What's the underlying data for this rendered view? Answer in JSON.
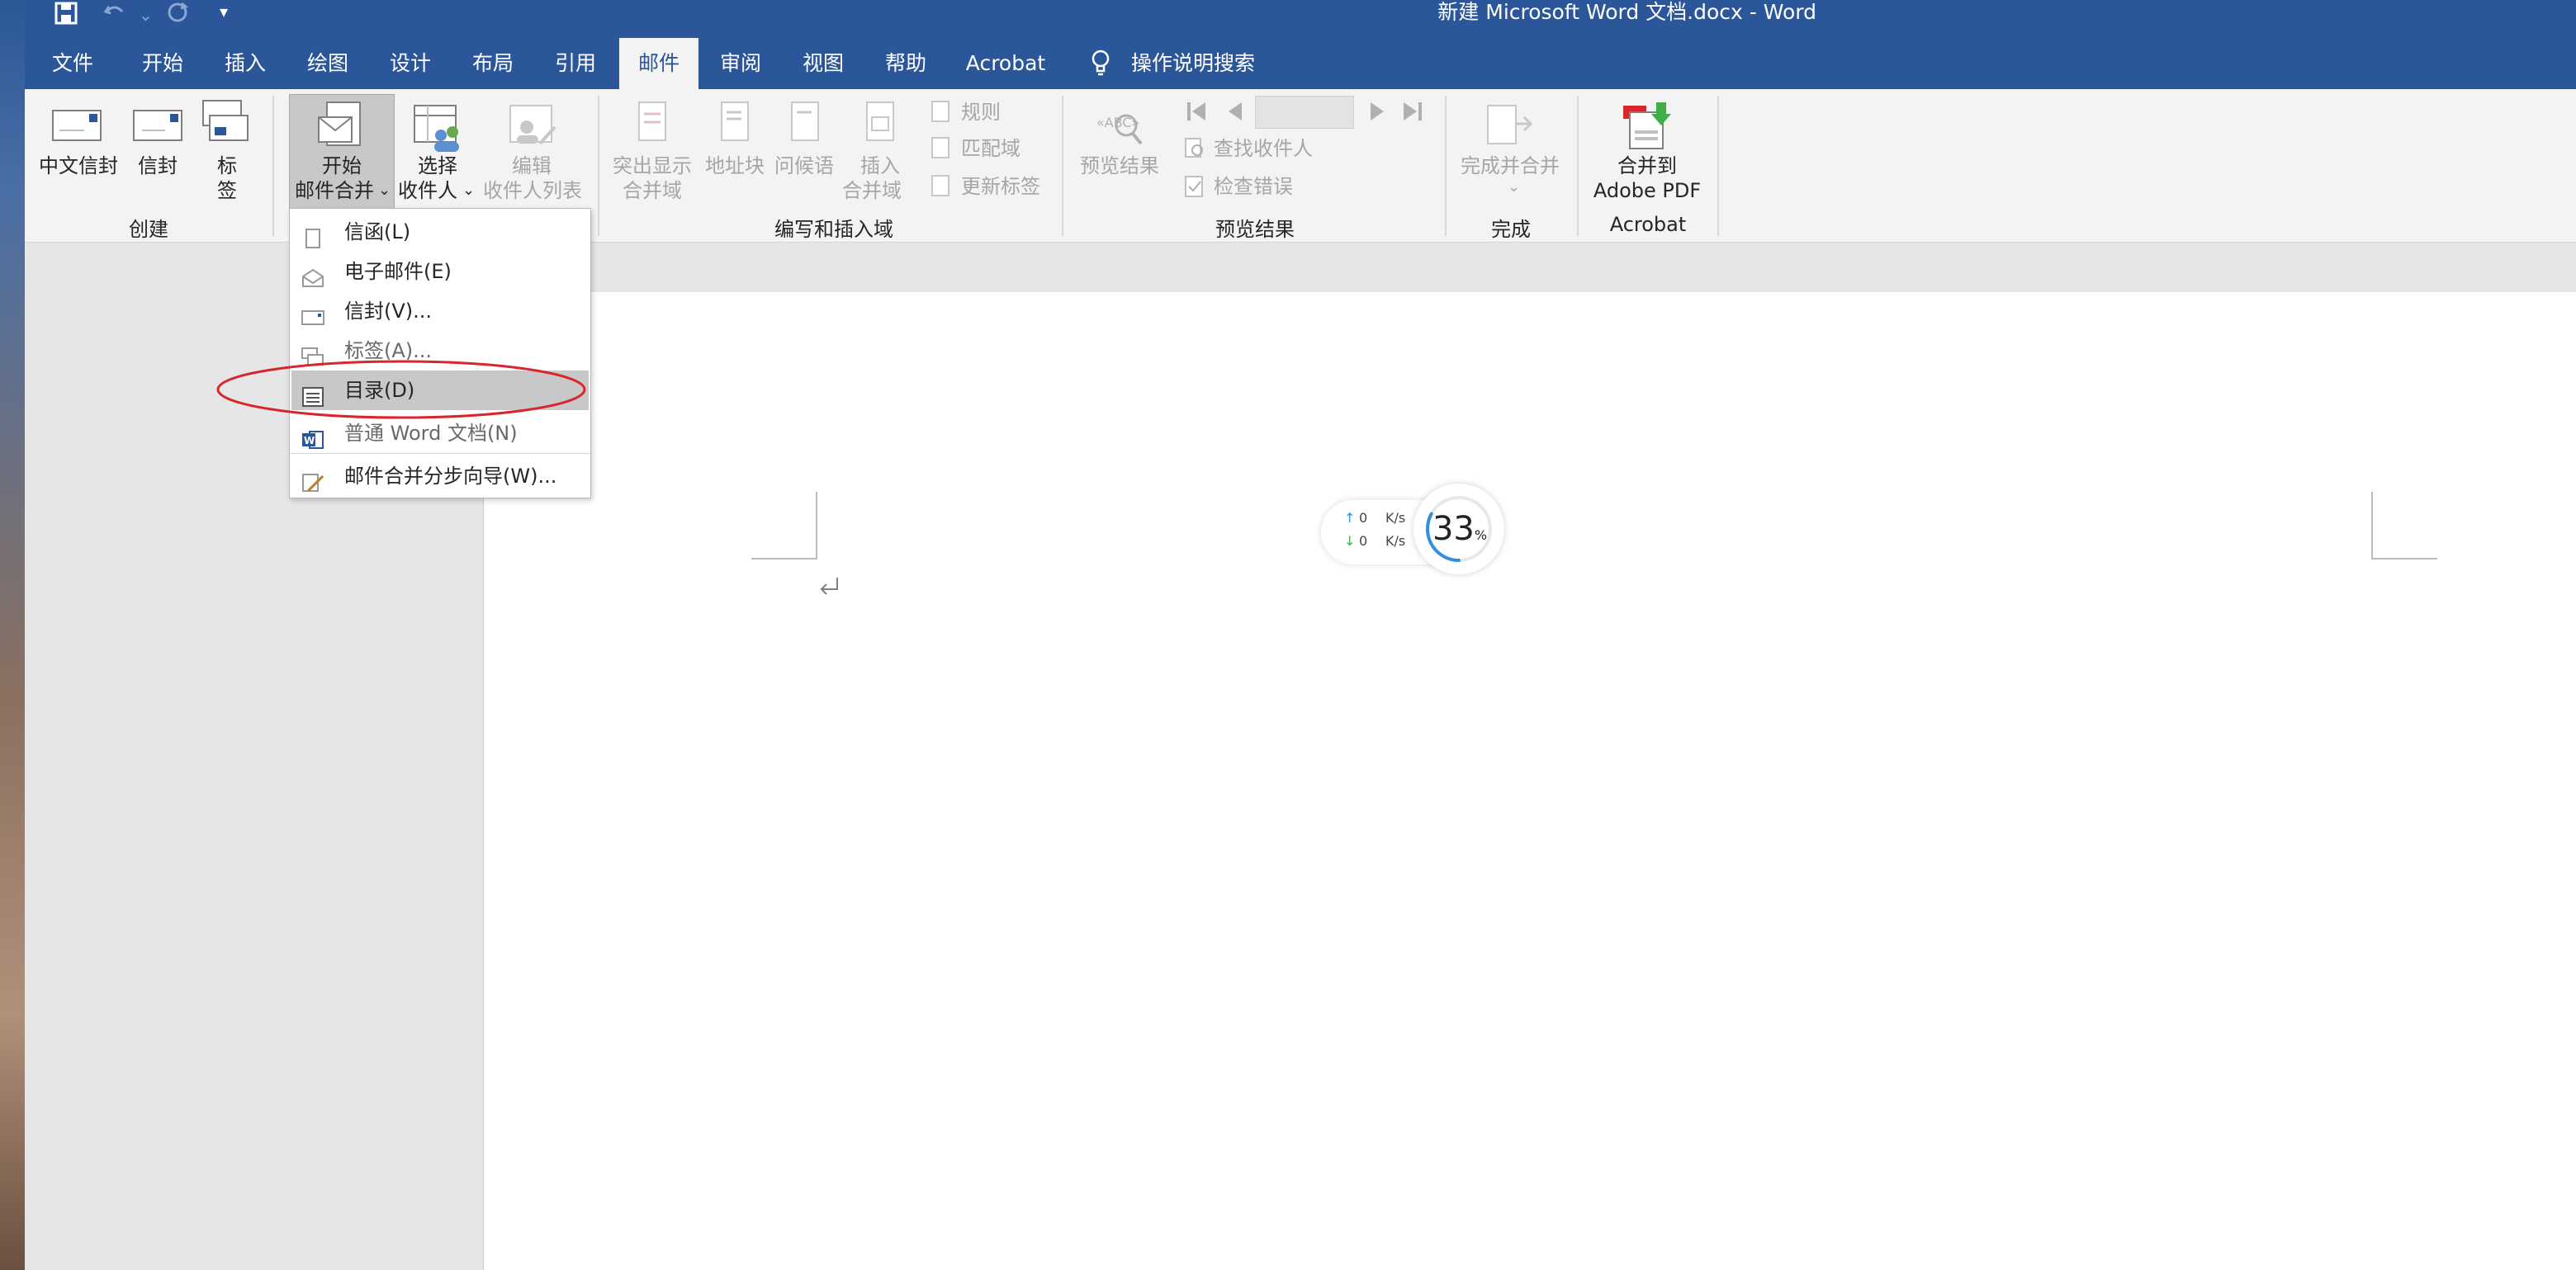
{
  "window": {
    "title": "新建 Microsoft Word 文档.docx  -  Word"
  },
  "quick_access": {
    "icons": [
      "save-icon",
      "undo-icon",
      "redo-icon",
      "customize-icon"
    ],
    "customize_glyph": "▾"
  },
  "tabs": [
    "文件",
    "开始",
    "插入",
    "绘图",
    "设计",
    "布局",
    "引用",
    "邮件",
    "审阅",
    "视图",
    "帮助",
    "Acrobat"
  ],
  "active_tab": "邮件",
  "tell_me": "操作说明搜索",
  "ribbon": {
    "create": {
      "label": "创建",
      "chinese_envelope": "中文信封",
      "envelope": "信封",
      "labels_line1": "标",
      "labels_line2": "签"
    },
    "start_merge": {
      "start_line1": "开始",
      "start_line2": "邮件合并",
      "select_line1": "选择",
      "select_line2": "收件人",
      "edit_line1": "编辑",
      "edit_line2": "收件人列表"
    },
    "write_insert": {
      "label": "编写和插入域",
      "highlight_line1": "突出显示",
      "highlight_line2": "合并域",
      "address_block": "地址块",
      "greeting": "问候语",
      "insert_line1": "插入",
      "insert_line2": "合并域",
      "rules": "规则",
      "match_fields": "匹配域",
      "update_labels": "更新标签"
    },
    "preview": {
      "label": "预览结果",
      "preview_results": "预览结果",
      "find_recipient": "查找收件人",
      "check_errors": "检查错误"
    },
    "finish": {
      "label": "完成",
      "finish_merge": "完成并合并"
    },
    "acrobat": {
      "label": "Acrobat",
      "merge_line1": "合并到",
      "merge_line2": "Adobe PDF"
    }
  },
  "dropdown": {
    "items": [
      {
        "label": "信函(L)",
        "icon": "letter-icon"
      },
      {
        "label": "电子邮件(E)",
        "icon": "email-icon"
      },
      {
        "label": "信封(V)...",
        "icon": "envelope-icon"
      },
      {
        "label": "标签(A)...",
        "icon": "labels-icon"
      },
      {
        "label": "目录(D)",
        "icon": "directory-icon",
        "highlighted": true
      },
      {
        "label": "普通 Word 文档(N)",
        "icon": "word-doc-icon"
      },
      {
        "label": "邮件合并分步向导(W)...",
        "icon": "wizard-icon"
      }
    ]
  },
  "network_widget": {
    "upload": "0",
    "download": "0",
    "unit": "K/s",
    "percent": "33",
    "percent_sign": "%"
  },
  "colors": {
    "title_bar": "#2b579a",
    "ribbon": "#f3f3f3",
    "highlight_oval": "#d9262c"
  }
}
